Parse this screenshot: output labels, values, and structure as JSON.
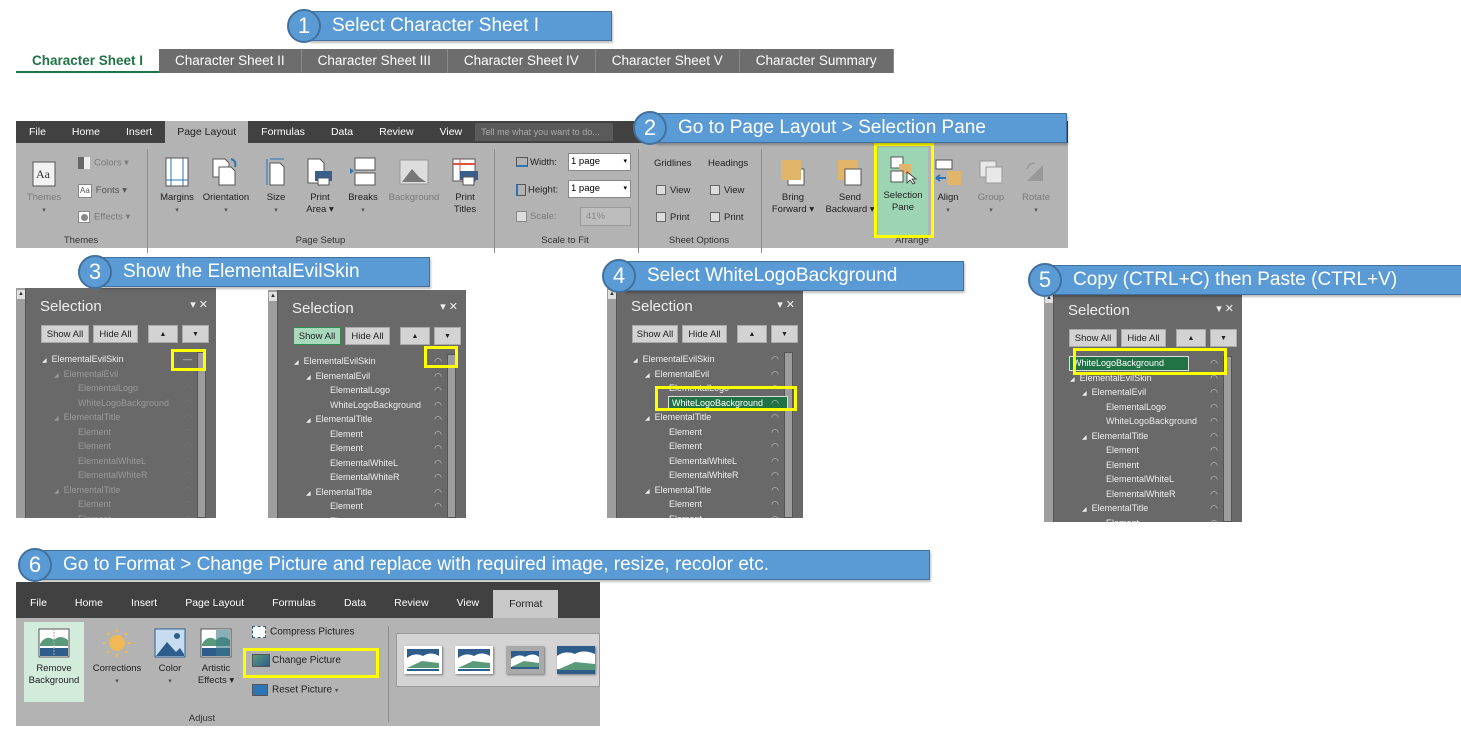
{
  "steps": [
    {
      "num": "1",
      "text": "Select Character Sheet I"
    },
    {
      "num": "2",
      "text": "Go to Page Layout > Selection Pane"
    },
    {
      "num": "3",
      "text": "Show the ElementalEvilSkin"
    },
    {
      "num": "4",
      "text": "Select WhiteLogoBackground"
    },
    {
      "num": "5",
      "text": "Copy (CTRL+C) then Paste (CTRL+V)"
    },
    {
      "num": "6",
      "text": "Go to Format > Change Picture and replace with required image, resize, recolor etc."
    }
  ],
  "sheet_tabs": [
    "Character Sheet I",
    "Character Sheet II",
    "Character Sheet III",
    "Character Sheet IV",
    "Character Sheet V",
    "Character Summary"
  ],
  "ribbon1": {
    "tabs": [
      "File",
      "Home",
      "Insert",
      "Page Layout",
      "Formulas",
      "Data",
      "Review",
      "View"
    ],
    "active_tab": "Page Layout",
    "tell_me": "Tell me what you want to do...",
    "themes": {
      "themes": "Themes",
      "colors": "Colors ▾",
      "fonts": "Fonts ▾",
      "effects": "Effects ▾",
      "label": "Themes"
    },
    "page_setup": {
      "margins": "Margins",
      "orientation": "Orientation",
      "size": "Size",
      "print_area_1": "Print",
      "print_area_2": "Area ▾",
      "breaks": "Breaks",
      "background": "Background",
      "print_titles_1": "Print",
      "print_titles_2": "Titles",
      "label": "Page Setup"
    },
    "scale_to_fit": {
      "width_label": "Width:",
      "width_value": "1 page",
      "height_label": "Height:",
      "height_value": "1 page",
      "scale_label": "Scale:",
      "scale_value": "41%",
      "label": "Scale to Fit"
    },
    "sheet_options": {
      "gridlines": "Gridlines",
      "headings": "Headings",
      "view": "View",
      "print": "Print",
      "label": "Sheet Options"
    },
    "arrange": {
      "bring_1": "Bring",
      "bring_2": "Forward ▾",
      "send_1": "Send",
      "send_2": "Backward ▾",
      "sel_1": "Selection",
      "sel_2": "Pane",
      "align": "Align",
      "group": "Group",
      "rotate": "Rotate",
      "label": "Arrange"
    }
  },
  "pane": {
    "title": "Selection",
    "show_all": "Show All",
    "hide_all": "Hide All"
  },
  "tree": [
    {
      "label": "ElementalEvilSkin",
      "level": 0,
      "expandable": true
    },
    {
      "label": "ElementalEvil",
      "level": 1,
      "expandable": true
    },
    {
      "label": "ElementalLogo",
      "level": 2,
      "expandable": false
    },
    {
      "label": "WhiteLogoBackground",
      "level": 2,
      "expandable": false
    },
    {
      "label": "ElementalTitle",
      "level": 1,
      "expandable": true
    },
    {
      "label": "Element",
      "level": 2,
      "expandable": false
    },
    {
      "label": "Element",
      "level": 2,
      "expandable": false
    },
    {
      "label": "ElementalWhiteL",
      "level": 2,
      "expandable": false
    },
    {
      "label": "ElementalWhiteR",
      "level": 2,
      "expandable": false
    },
    {
      "label": "ElementalTitle",
      "level": 1,
      "expandable": true
    },
    {
      "label": "Element",
      "level": 2,
      "expandable": false
    },
    {
      "label": "Element",
      "level": 2,
      "expandable": false
    }
  ],
  "pasted_item": "WhiteLogoBackground",
  "ribbon2": {
    "tabs": [
      "File",
      "Home",
      "Insert",
      "Page Layout",
      "Formulas",
      "Data",
      "Review",
      "View",
      "Format"
    ],
    "active_tab": "Format",
    "remove_bg_1": "Remove",
    "remove_bg_2": "Background",
    "corrections": "Corrections",
    "color": "Color",
    "artistic_1": "Artistic",
    "artistic_2": "Effects ▾",
    "compress": "Compress Pictures",
    "change": "Change Picture",
    "reset": "Reset Picture",
    "group_label": "Adjust"
  },
  "colors": {
    "callout": "#5b9bd5",
    "highlight": "#ffff00",
    "excel_green": "#217346"
  }
}
